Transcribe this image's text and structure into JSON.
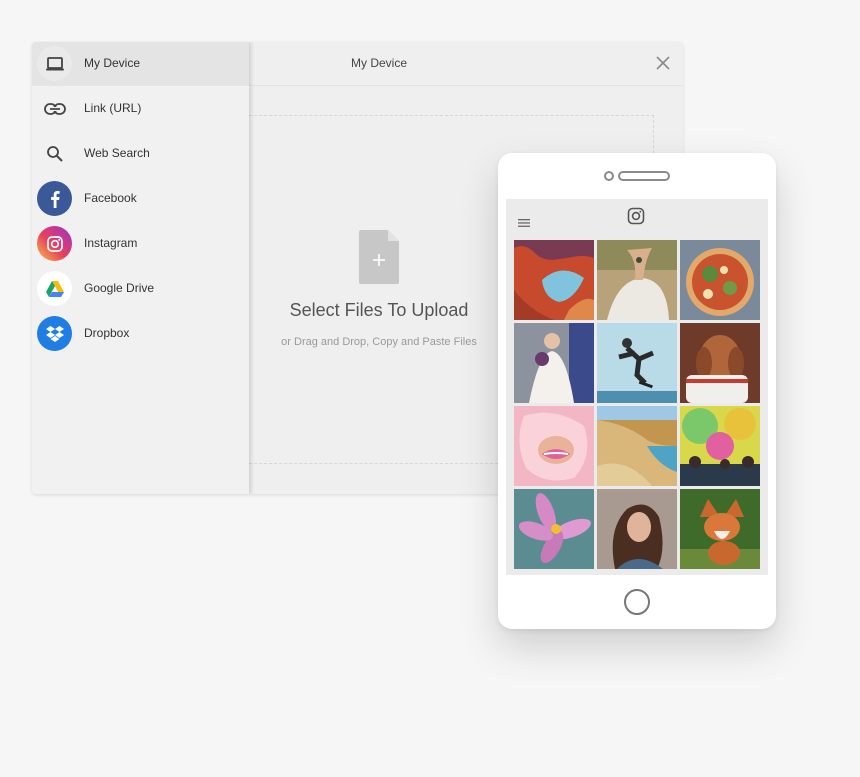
{
  "sidebar": {
    "items": [
      {
        "key": "my-device",
        "label": "My Device",
        "icon": "laptop-icon",
        "active": true
      },
      {
        "key": "link-url",
        "label": "Link (URL)",
        "icon": "link-icon"
      },
      {
        "key": "web-search",
        "label": "Web Search",
        "icon": "search-icon"
      },
      {
        "key": "facebook",
        "label": "Facebook",
        "icon": "facebook-icon",
        "color": "#3b5998"
      },
      {
        "key": "instagram",
        "label": "Instagram",
        "icon": "instagram-icon"
      },
      {
        "key": "google-drive",
        "label": "Google Drive",
        "icon": "google-drive-icon"
      },
      {
        "key": "dropbox",
        "label": "Dropbox",
        "icon": "dropbox-icon",
        "color": "#1f7de3"
      }
    ]
  },
  "header": {
    "title": "My Device",
    "close_icon": "close-icon"
  },
  "dropzone": {
    "title": "Select Files To Upload",
    "subtitle": "or Drag and Drop, Copy and Paste Files",
    "icon": "file-add-icon"
  },
  "phone": {
    "menu_icon": "hamburger-menu-icon",
    "logo_icon": "instagram-icon",
    "photos": [
      "canyon-photo",
      "bride-hand-photo",
      "pizza-photo",
      "wedding-photo",
      "skateboarder-photo",
      "dog-photo",
      "lips-photo",
      "beach-photo",
      "color-festival-photo",
      "flower-photo",
      "woman-portrait-photo",
      "fox-photo"
    ]
  },
  "colors": {
    "facebook": "#3b5998",
    "dropbox": "#1f7de3",
    "page_bg": "#f6f6f6"
  }
}
